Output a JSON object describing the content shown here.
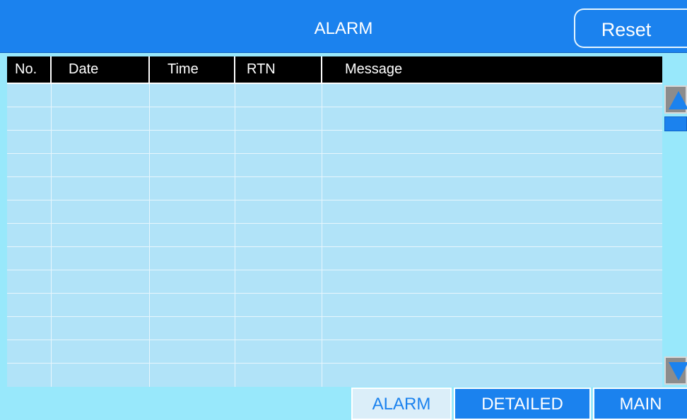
{
  "header": {
    "title": "ALARM",
    "reset_label": "Reset"
  },
  "table": {
    "columns": [
      "No.",
      "Date",
      "Time",
      "RTN",
      "Message"
    ]
  },
  "nav": {
    "alarm_label": "ALARM",
    "detailed_label": "DETAILED",
    "main_label": "MAIN"
  },
  "colors": {
    "accent": "#1B82EE",
    "table_background": "#B1E3F8",
    "screen_background": "#98E8FB",
    "header_row": "#000000"
  }
}
